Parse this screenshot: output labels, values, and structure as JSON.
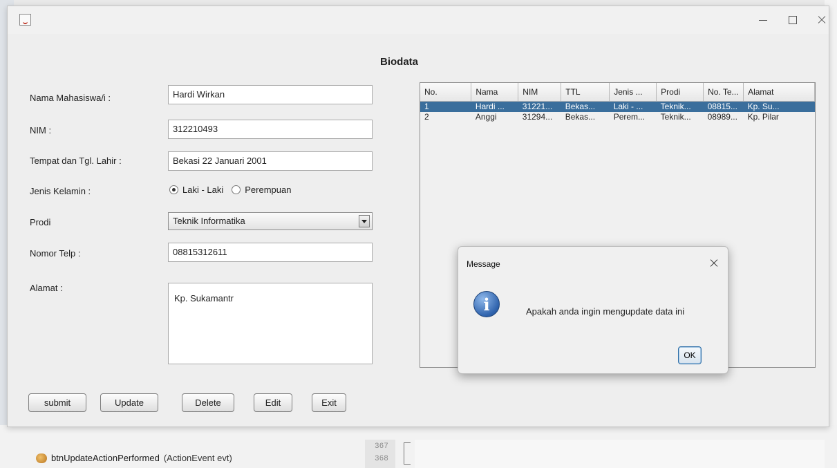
{
  "background_ide": {
    "method_name": "btnUpdateActionPerformed",
    "method_args": "(ActionEvent evt)",
    "line_numbers": [
      "367",
      "368"
    ]
  },
  "window": {
    "form_title": "Biodata"
  },
  "form": {
    "nama_label": "Nama Mahasiswa/i  :",
    "nama_value": "Hardi Wirkan",
    "nim_label": "NIM :",
    "nim_value": "312210493",
    "ttl_label": "Tempat dan Tgl. Lahir :",
    "ttl_value": "Bekasi 22 Januari 2001",
    "gender_label": "Jenis Kelamin :",
    "gender_options": [
      "Laki - Laki",
      "Perempuan"
    ],
    "gender_selected": "Laki - Laki",
    "prodi_label": "Prodi",
    "prodi_value": "Teknik Informatika",
    "telp_label": "Nomor Telp :",
    "telp_value": "08815312611",
    "alamat_label": "Alamat :",
    "alamat_value": "Kp. Sukamantr"
  },
  "buttons": {
    "submit": "submit",
    "update": "Update",
    "delete": "Delete",
    "edit": "Edit",
    "exit": "Exit"
  },
  "table": {
    "columns": [
      "No.",
      "Nama",
      "NIM",
      "TTL",
      "Jenis ...",
      "Prodi",
      "No. Te...",
      "Alamat"
    ],
    "rows": [
      [
        "1",
        "Hardi ...",
        "31221...",
        "Bekas...",
        "Laki - ...",
        "Teknik...",
        "08815...",
        "Kp. Su..."
      ],
      [
        "2",
        "Anggi",
        "31294...",
        "Bekas...",
        "Perem...",
        "Teknik...",
        "08989...",
        "Kp. Pilar"
      ]
    ],
    "selected_row": 0
  },
  "dialog": {
    "title": "Message",
    "message": "Apakah anda ingin mengupdate data ini",
    "ok_label": "OK"
  },
  "colors": {
    "selected_row": "#3a6e9c",
    "window_bg": "#eeeeee"
  }
}
